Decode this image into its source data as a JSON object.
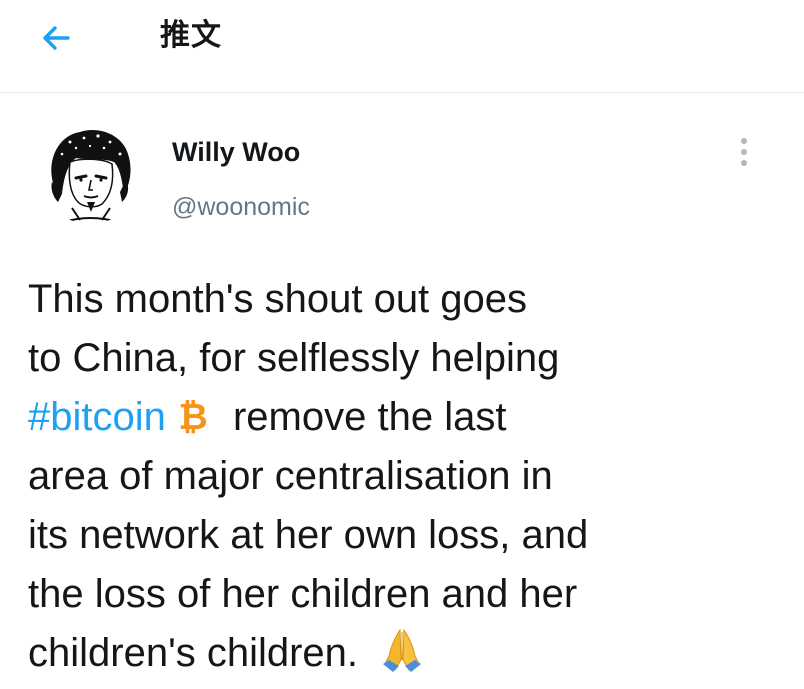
{
  "header": {
    "title": "推文",
    "back_icon": "arrow-left-icon"
  },
  "tweet": {
    "author": {
      "display_name": "Willy Woo",
      "handle": "@woonomic",
      "avatar_icon": "sketch-portrait-avatar"
    },
    "more_icon": "more-vertical-icon",
    "lines": [
      {
        "text": "This month's shout out goes"
      },
      {
        "text": "to China, for selflessly helping"
      },
      {
        "hashtag": "#bitcoin",
        "emoji": "bitcoin-icon",
        "text": " remove the last"
      },
      {
        "text": "area of major centralisation in"
      },
      {
        "text": "its network at her own loss, and"
      },
      {
        "text": "the loss of her children and her"
      },
      {
        "text": "children's children. ",
        "emoji": "folded-hands-emoji"
      }
    ]
  },
  "colors": {
    "accent": "#1da1f2",
    "text": "#14171a",
    "secondary_text": "#657786",
    "bitcoin_orange": "#f7931a",
    "divider": "#e1e8ed"
  }
}
